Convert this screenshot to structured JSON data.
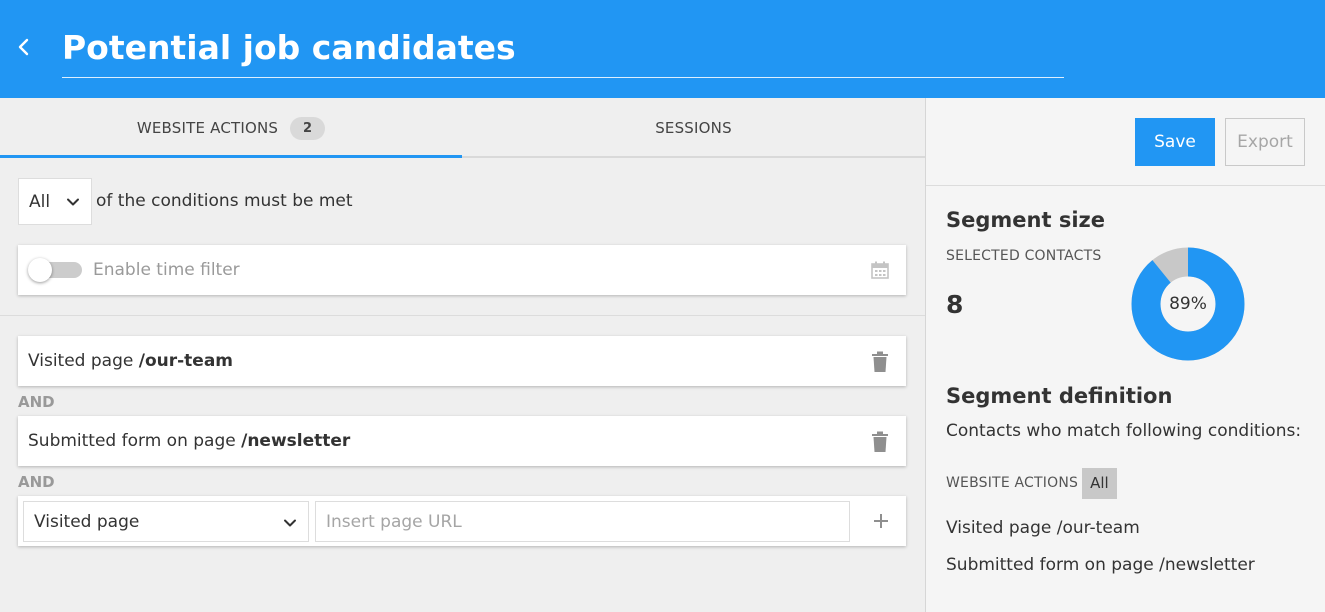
{
  "header": {
    "title": "Potential job candidates"
  },
  "tabs": [
    {
      "label": "WEBSITE ACTIONS",
      "badge": "2"
    },
    {
      "label": "SESSIONS"
    }
  ],
  "filter": {
    "match_value": "All",
    "match_suffix": "of the conditions must be met",
    "time_filter_label": "Enable time filter",
    "time_filter_enabled": false
  },
  "conditions": [
    {
      "prefix": "Visited page",
      "value": "/our-team"
    },
    {
      "prefix": "Submitted form on page",
      "value": "/newsletter"
    }
  ],
  "and_label": "AND",
  "new_condition": {
    "type_value": "Visited page",
    "url_placeholder": "Insert page URL"
  },
  "actions": {
    "save_label": "Save",
    "export_label": "Export"
  },
  "segment_size": {
    "title": "Segment size",
    "selected_label": "SELECTED CONTACTS",
    "count": "8",
    "percent_label": "89%",
    "percent_value": 89
  },
  "segment_definition": {
    "title": "Segment definition",
    "description": "Contacts who match following conditions:",
    "group_label": "WEBSITE ACTIONS",
    "group_match": "All",
    "items": [
      "Visited page /our-team",
      "Submitted form on page /newsletter"
    ]
  },
  "colors": {
    "primary": "#2196f3",
    "donut_remainder": "#c8c8c8",
    "muted_text": "#9a9a9a"
  },
  "icons": {
    "back": "chevron-left-icon",
    "calendar": "calendar-icon",
    "delete": "trash-icon",
    "add": "plus-icon",
    "dropdown": "chevron-down-icon"
  }
}
